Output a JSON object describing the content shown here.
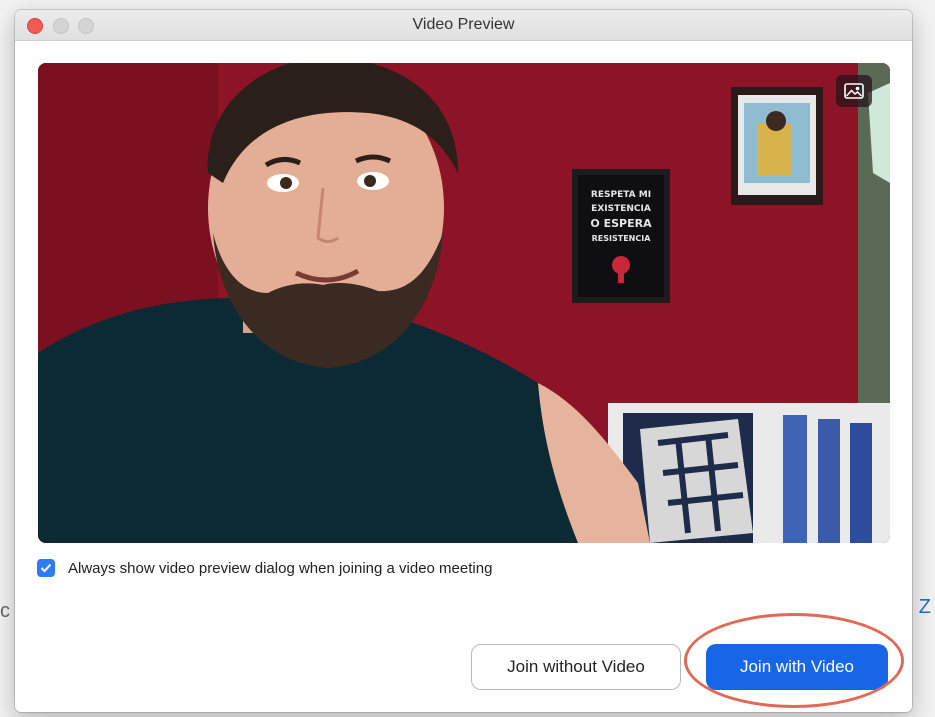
{
  "window": {
    "title": "Video Preview"
  },
  "background_text": {
    "left": "c",
    "right": "Z"
  },
  "video": {
    "poster_text": [
      "RESPETA MI",
      "EXISTENCIA",
      "O ESPERA",
      "RESISTENCIA"
    ],
    "background_button_icon": "image-icon"
  },
  "checkbox": {
    "checked": true,
    "label": "Always show video preview dialog when joining a video meeting"
  },
  "buttons": {
    "join_without_video": "Join without Video",
    "join_with_video": "Join with Video"
  },
  "colors": {
    "primary": "#1866e8",
    "checkbox": "#2f7bf6",
    "highlight": "#e06a55",
    "close": "#f25a52"
  }
}
